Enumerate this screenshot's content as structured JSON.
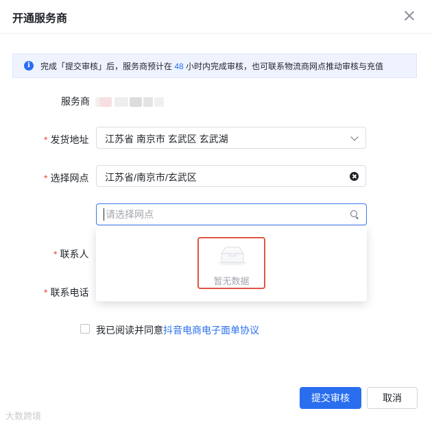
{
  "dialog": {
    "title": "开通服务商"
  },
  "alert": {
    "text_before": "完成「提交审核」后，服务商预计在 ",
    "highlight": "48",
    "text_after": " 小时内完成审核，也可联系物流商网点推动审核与充值"
  },
  "form": {
    "vendor_label": "服务商",
    "address_label": "发货地址",
    "address_value": "江苏省 南京市 玄武区 玄武湖",
    "outlet_label": "选择网点",
    "outlet_value": "江苏省/南京市/玄武区",
    "outlet_search_placeholder": "请选择网点",
    "contact_label": "联系人",
    "phone_label": "联系电话",
    "required_mark": "*"
  },
  "dropdown": {
    "empty_text": "暂无数据"
  },
  "agreement": {
    "prefix": "我已阅读并同意",
    "link": "抖音电商电子面单协议"
  },
  "buttons": {
    "submit": "提交审核",
    "cancel": "取消"
  },
  "watermark": "大数跨境",
  "colors": {
    "primary": "#2a6ef0",
    "required": "#e8463a",
    "highlight_border": "#e15247"
  }
}
